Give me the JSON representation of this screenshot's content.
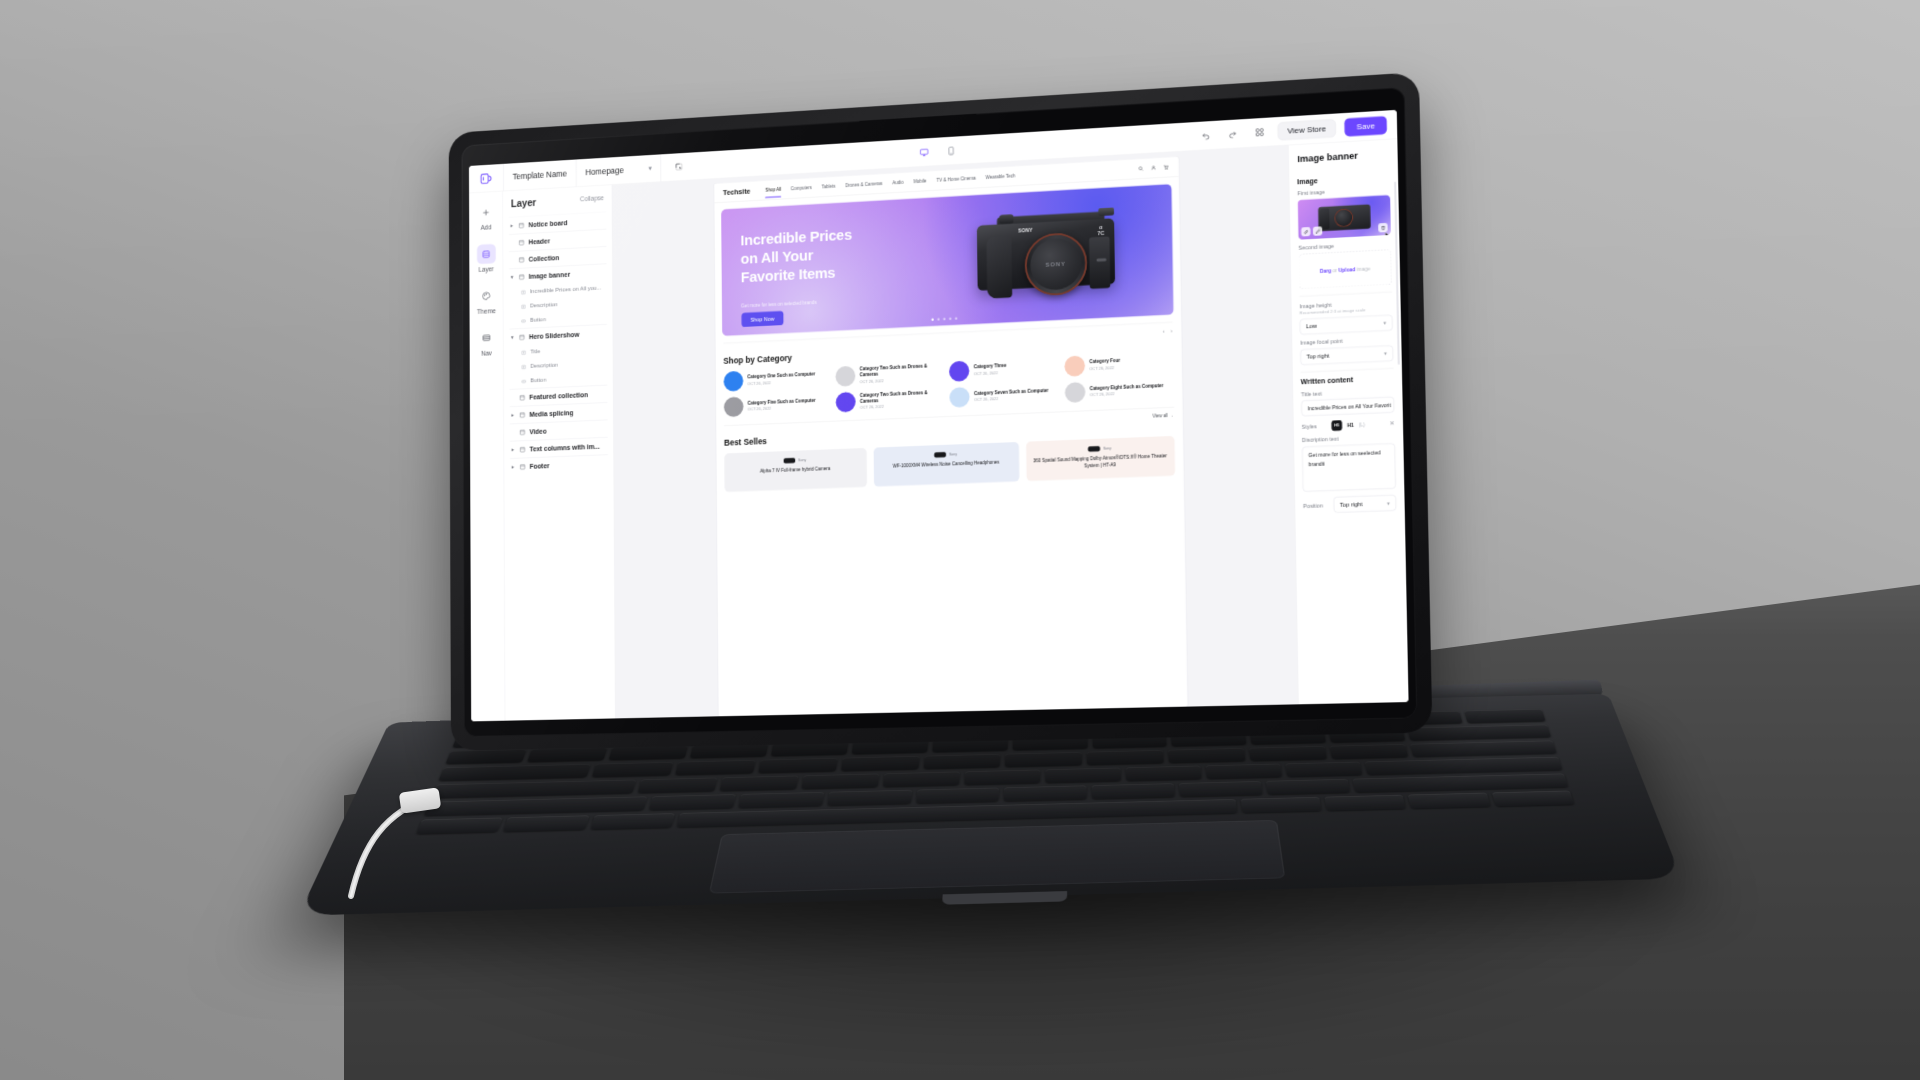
{
  "app": {
    "logo": "brand-logo",
    "template_label": "Template Name",
    "page_select": "Homepage",
    "preview_icon": "cursor-select-icon",
    "device_desktop": "desktop-icon",
    "device_mobile": "mobile-icon",
    "undo": "undo-icon",
    "redo": "redo-icon",
    "grid": "grid-icon",
    "view_store": "View Store",
    "save": "Save",
    "accent": "#6C47FF"
  },
  "rail": {
    "items": [
      {
        "label": "Add",
        "icon": "plus-icon",
        "active": false
      },
      {
        "label": "Layer",
        "icon": "layers-icon",
        "active": true
      },
      {
        "label": "Theme",
        "icon": "palette-icon",
        "active": false
      },
      {
        "label": "Nav",
        "icon": "nav-icon",
        "active": false
      }
    ]
  },
  "layer_panel": {
    "title": "Layer",
    "collapse": "Collapse",
    "items": [
      {
        "label": "Notice board",
        "type": "group",
        "expanded": false,
        "arrow": "▸"
      },
      {
        "label": "Header",
        "type": "group",
        "expanded": null,
        "arrow": ""
      },
      {
        "label": "Collection",
        "type": "group",
        "expanded": null,
        "arrow": ""
      },
      {
        "label": "Image banner",
        "type": "group",
        "expanded": true,
        "arrow": "▾"
      },
      {
        "label": "Incredible Prices on All you...",
        "type": "child"
      },
      {
        "label": "Description",
        "type": "child"
      },
      {
        "label": "Button",
        "type": "child"
      },
      {
        "label": "Hero Slidershow",
        "type": "group",
        "expanded": true,
        "arrow": "▾"
      },
      {
        "label": "Title",
        "type": "child"
      },
      {
        "label": "Description",
        "type": "child"
      },
      {
        "label": "Button",
        "type": "child"
      },
      {
        "label": "Featured collection",
        "type": "group",
        "expanded": null,
        "arrow": ""
      },
      {
        "label": "Media splicing",
        "type": "group",
        "expanded": false,
        "arrow": "▸"
      },
      {
        "label": "Video",
        "type": "group",
        "expanded": null,
        "arrow": ""
      },
      {
        "label": "Text columns with im...",
        "type": "group",
        "expanded": false,
        "arrow": "▸"
      },
      {
        "label": "Footer",
        "type": "group",
        "expanded": false,
        "arrow": "▸"
      }
    ]
  },
  "site": {
    "brand": "Techsite",
    "nav": [
      {
        "label": "Shop All",
        "active": true
      },
      {
        "label": "Computers",
        "active": false
      },
      {
        "label": "Tablets",
        "active": false
      },
      {
        "label": "Drones & Cameras",
        "active": false
      },
      {
        "label": "Audio",
        "active": false
      },
      {
        "label": "Mobile",
        "active": false
      },
      {
        "label": "TV & Home Cinema",
        "active": false
      },
      {
        "label": "Wearable Tech",
        "active": false
      }
    ],
    "actions": [
      "search-icon",
      "account-icon",
      "cart-icon"
    ],
    "hero": {
      "title": "Incredible Prices\non All Your\nFavorite Items",
      "subtitle": "Get more for less on selected brands",
      "cta": "Shop Now",
      "camera_brand": "SONY",
      "camera_model": "α\n7C",
      "lens_text": "SONY",
      "dots": 5,
      "active_dot": 0
    },
    "category_section": {
      "title": "Shop by Category",
      "prev": "‹",
      "next": "›",
      "items": [
        {
          "name": "Category One Such as Computer",
          "date": "OCT 26, 2022",
          "color": "#2A7FF0"
        },
        {
          "name": "Category Two Such as Drones & Cameras",
          "date": "OCT 26, 2022",
          "color": "#D6D6DA"
        },
        {
          "name": "Category Three",
          "date": "OCT 26, 2022",
          "color": "#6246F0"
        },
        {
          "name": "Category Four",
          "date": "OCT 26, 2022",
          "color": "#F9CDBB"
        },
        {
          "name": "Category Five Such as Computer",
          "date": "OCT 26, 2022",
          "color": "#9A9AA0"
        },
        {
          "name": "Category Two Such as Drones & Cameras",
          "date": "OCT 26, 2022",
          "color": "#6246F0"
        },
        {
          "name": "Category Seven Such as Computer",
          "date": "OCT 26, 2022",
          "color": "#C9DFF8"
        },
        {
          "name": "Category Eight Such as Computer",
          "date": "OCT 26, 2022",
          "color": "#D6D6DA"
        }
      ]
    },
    "best_sellers": {
      "title": "Best Selles",
      "view_all": "View all →",
      "products": [
        {
          "brand": "Sony",
          "name": "Alpha 7 IV Full-frame hybrid Camera",
          "bg": "#F1F1F4"
        },
        {
          "brand": "Sony",
          "name": "WF-1000XM4 Wireless Noise Cancelling Headphones",
          "bg": "#E7ECF7"
        },
        {
          "brand": "Sony",
          "name": "360 Spatial Sound Mapping Dolby Atmos®/DTS:X® Home Theater System | HT-A9",
          "bg": "#FAF1EE"
        }
      ]
    }
  },
  "props": {
    "title": "Image banner",
    "image_section": "Image",
    "first_image_label": "First image",
    "first_image_tools": [
      "link-icon",
      "edit-icon"
    ],
    "first_image_delete": "delete-icon",
    "second_image_label": "Second image",
    "upload_drag": "Darg",
    "upload_or": " or ",
    "upload_link": "Upload",
    "upload_suffix": " image",
    "image_height_label": "Image height",
    "image_height_hint": "Recommended 2:3 at image scale",
    "image_height_value": "Low",
    "focal_point_label": "Image focal point",
    "focal_point_value": "Top right",
    "written_content": "Written content",
    "title_text_label": "Title text",
    "title_text_value": "Incredible Prices on All Your Favorit",
    "styles_label": "Styles",
    "styles_chip": "H1",
    "styles_name": "H1",
    "styles_sub": "(L)",
    "styles_remove": "✕",
    "description_label": "Discription text",
    "description_value": "Get more for less on seelected brandti",
    "position_label": "Position",
    "position_value": "Top right"
  }
}
